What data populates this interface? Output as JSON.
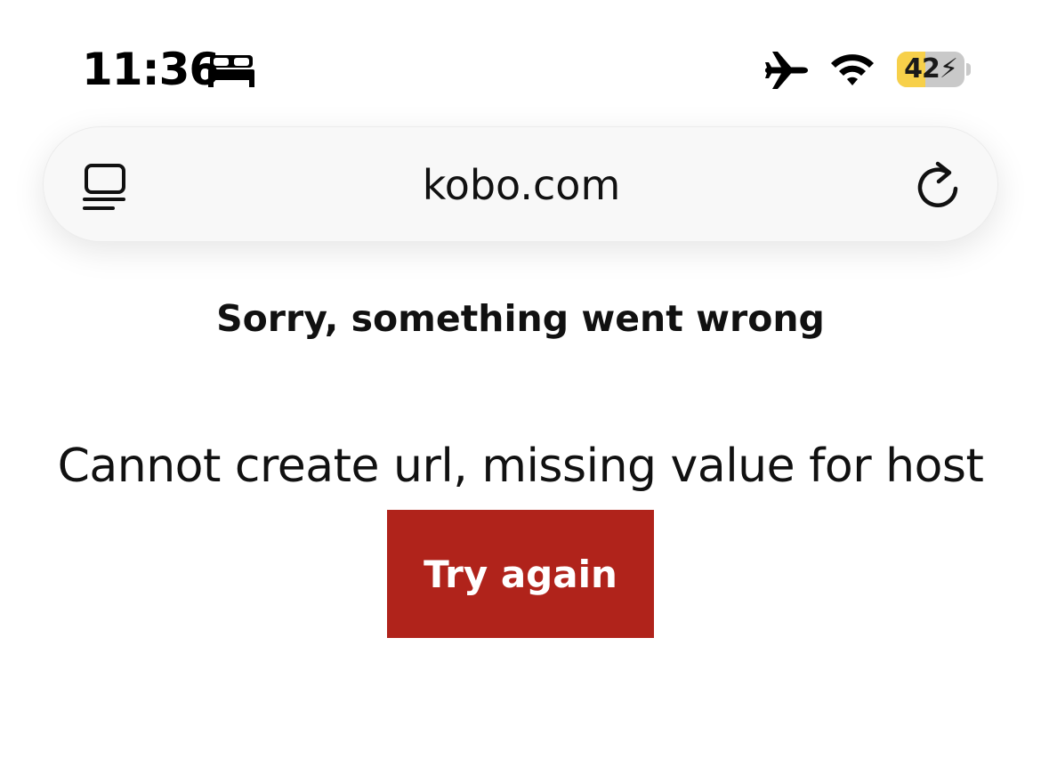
{
  "status_bar": {
    "time": "11:36",
    "focus_icon": "bed-icon",
    "airplane_icon": "airplane-icon",
    "wifi_icon": "wifi-icon",
    "battery_percent": "42",
    "battery_level": 0.42,
    "battery_charging": true,
    "battery_color": "#f7d04a"
  },
  "address_bar": {
    "url": "kobo.com",
    "left_icon": "reader-mode-icon",
    "right_icon": "reload-icon"
  },
  "content": {
    "title": "Sorry, something went wrong",
    "message": "Cannot create url, missing value for host",
    "retry_label": "Try again",
    "button_color": "#b0231b"
  }
}
